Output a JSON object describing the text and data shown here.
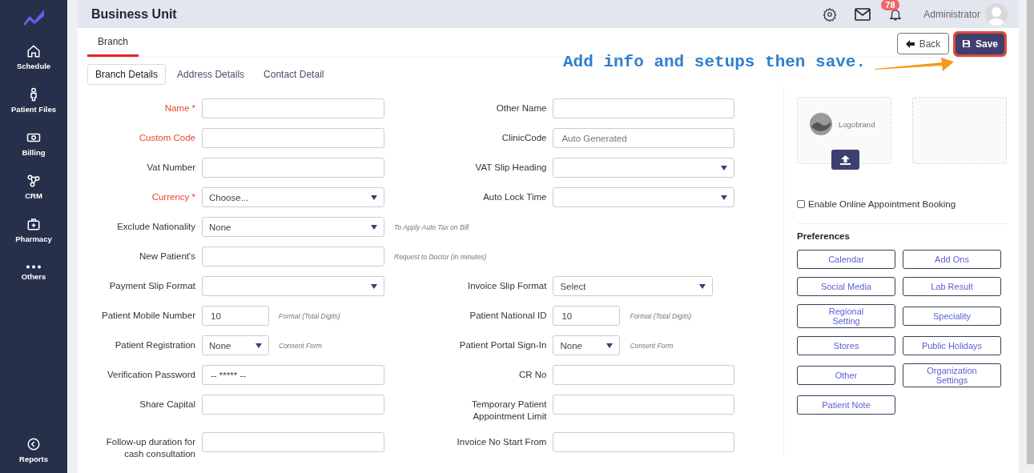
{
  "sidebar": {
    "items": [
      {
        "label": "Schedule"
      },
      {
        "label": "Patient Files"
      },
      {
        "label": "Billing"
      },
      {
        "label": "CRM"
      },
      {
        "label": "Pharmacy"
      },
      {
        "label": "Others"
      }
    ],
    "footer_item": {
      "label": "Reports"
    }
  },
  "header": {
    "title": "Business Unit",
    "notification_count": "78",
    "user": "Administrator"
  },
  "tabs": [
    {
      "label": "Branch",
      "selected": true
    }
  ],
  "actions": {
    "back": "Back",
    "save": "Save"
  },
  "annotation": {
    "text": "Add info and setups then save."
  },
  "subtabs": [
    {
      "label": "Branch Details",
      "selected": true
    },
    {
      "label": "Address Details",
      "selected": false
    },
    {
      "label": "Contact Detail",
      "selected": false
    }
  ],
  "form_rows": [
    {
      "left": {
        "label": "Name *",
        "required": true,
        "kind": "textbox"
      },
      "right": {
        "label": "Other Name",
        "required": false,
        "kind": "textbox"
      }
    },
    {
      "left": {
        "label": "Custom Code",
        "required": true,
        "kind": "textbox"
      },
      "right": {
        "label": "ClinicCode",
        "required": false,
        "kind": "textbox",
        "placeholder": "Auto Generated"
      }
    },
    {
      "left": {
        "label": "Vat Number",
        "required": false,
        "kind": "textbox"
      },
      "right": {
        "label": "VAT Slip Heading",
        "required": false,
        "kind": "select"
      }
    },
    {
      "left": {
        "label": "Currency *",
        "required": true,
        "kind": "select",
        "value": "Choose..."
      },
      "right": {
        "label": "Auto Lock Time",
        "required": false,
        "kind": "select"
      }
    },
    {
      "left": {
        "label": "Exclude Nationality",
        "required": false,
        "kind": "select",
        "value": "None",
        "hint": "To Apply Auto Tax on Bill"
      }
    },
    {
      "left": {
        "label": "New Patient's",
        "required": false,
        "kind": "textbox",
        "hint": "Request to Doctor (in minutes)"
      }
    },
    {
      "left": {
        "label": "Payment Slip Format",
        "required": false,
        "kind": "select"
      },
      "right": {
        "label": "Invoice Slip Format",
        "required": false,
        "kind": "select",
        "value": "Select"
      }
    },
    {
      "left": {
        "label": "Patient Mobile Number",
        "required": false,
        "kind": "smallbox",
        "value": "10",
        "hint": "Format (Total Digits)"
      },
      "right": {
        "label": "Patient National ID",
        "required": false,
        "kind": "smallbox",
        "value": "10",
        "hint": "Format (Total Digits)"
      }
    },
    {
      "left": {
        "label": "Patient Registration",
        "required": false,
        "kind": "smallselect",
        "value": "None",
        "hint": "Consent Form"
      },
      "right": {
        "label": "Patient Portal Sign-In",
        "required": false,
        "kind": "smallselect",
        "value": "None",
        "hint": "Consent Form"
      }
    },
    {
      "left": {
        "label": "Verification Password",
        "required": false,
        "kind": "textbox",
        "value": "-- ***** --"
      },
      "right": {
        "label": "CR No",
        "required": false,
        "kind": "textbox"
      }
    },
    {
      "left": {
        "label": "Share Capital",
        "required": false,
        "kind": "textbox"
      },
      "right": {
        "label": "Temporary Patient Appointment Limit",
        "required": false,
        "kind": "textbox"
      }
    },
    {
      "left": {
        "label": "Follow-up duration for cash consultation",
        "required": false,
        "kind": "textbox"
      },
      "right": {
        "label": "Invoice No Start From",
        "required": false,
        "kind": "textbox"
      }
    }
  ],
  "side_panel": {
    "logo": {
      "text": "Logobrand"
    },
    "online_booking": {
      "label": "Enable Online Appointment Booking",
      "checked": false
    },
    "preferences": {
      "title": "Preferences",
      "buttons": [
        "Calendar",
        "Add Ons",
        "Social Media",
        "Lab Result",
        "Regional Setting",
        "Speciality",
        "Stores",
        "Public Holidays",
        "Other",
        "Organization Settings",
        "Patient Note"
      ]
    }
  }
}
